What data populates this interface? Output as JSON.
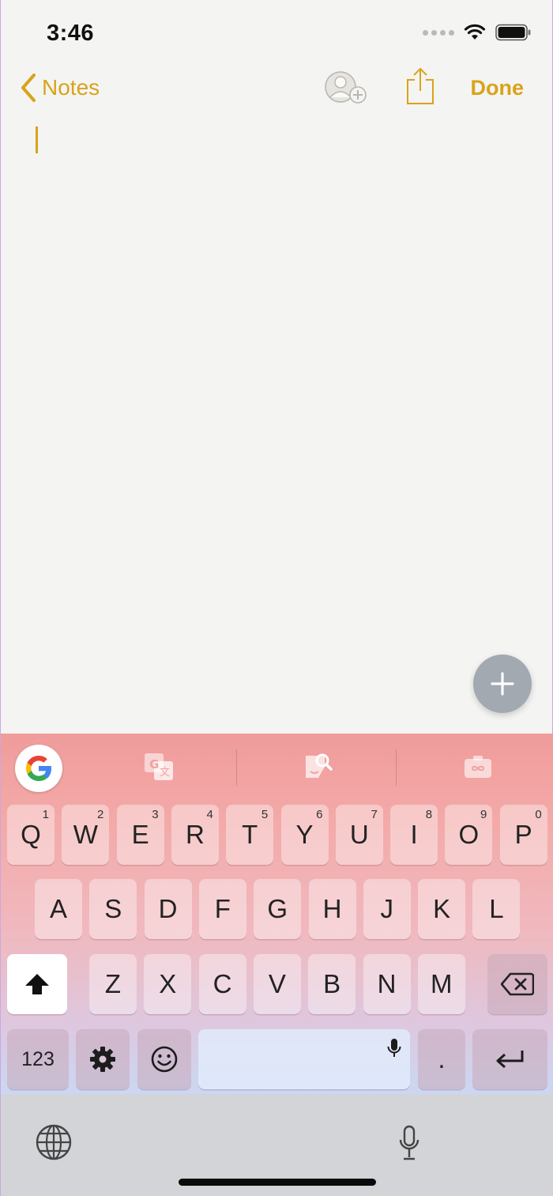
{
  "status": {
    "time": "3:46"
  },
  "nav": {
    "back_label": "Notes",
    "done_label": "Done"
  },
  "keyboard": {
    "row1": [
      {
        "label": "Q",
        "hint": "1"
      },
      {
        "label": "W",
        "hint": "2"
      },
      {
        "label": "E",
        "hint": "3"
      },
      {
        "label": "R",
        "hint": "4"
      },
      {
        "label": "T",
        "hint": "5"
      },
      {
        "label": "Y",
        "hint": "6"
      },
      {
        "label": "U",
        "hint": "7"
      },
      {
        "label": "I",
        "hint": "8"
      },
      {
        "label": "O",
        "hint": "9"
      },
      {
        "label": "P",
        "hint": "0"
      }
    ],
    "row2": [
      "A",
      "S",
      "D",
      "F",
      "G",
      "H",
      "J",
      "K",
      "L"
    ],
    "row3": [
      "Z",
      "X",
      "C",
      "V",
      "B",
      "N",
      "M"
    ],
    "numbers_label": "123",
    "period_label": ".",
    "accent_colors": {
      "top": "#f09c9b",
      "bottom": "#cbd7f3"
    }
  },
  "icons": {
    "nav": [
      "chevron-left-icon",
      "add-person-icon",
      "share-icon"
    ],
    "toolbar": [
      "google-g-icon",
      "translate-icon",
      "sticker-search-icon",
      "gif-camera-icon"
    ],
    "keys": [
      "shift-icon",
      "backspace-icon",
      "settings-icon",
      "emoji-icon",
      "mic-icon",
      "return-icon"
    ],
    "bottom": [
      "globe-icon",
      "dictation-mic-icon"
    ]
  },
  "theme": {
    "accent": "#d9a31a",
    "paper": "#f4f4f3"
  }
}
